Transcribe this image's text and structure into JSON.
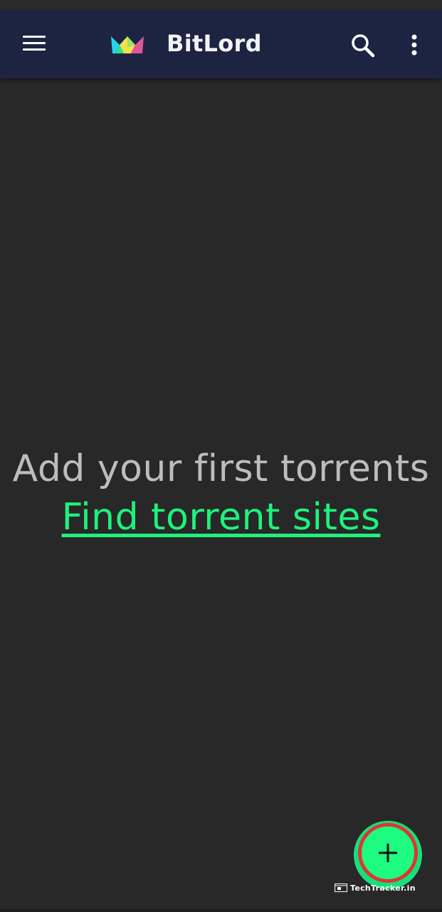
{
  "app_bar": {
    "title": "BitLord",
    "menu_icon": "hamburger-menu-icon",
    "logo_icon": "crown-logo-icon",
    "search_icon": "search-icon",
    "more_icon": "more-vertical-icon",
    "background_color": "#1d2442"
  },
  "main": {
    "empty_message": "Add your first torrents",
    "find_link_label": "Find torrent sites",
    "link_color": "#1ef27c"
  },
  "fab": {
    "icon": "plus-icon",
    "color": "#1dfb80",
    "highlight_ring_color": "#e03434"
  },
  "watermark": {
    "text": "TechTracker.in"
  }
}
